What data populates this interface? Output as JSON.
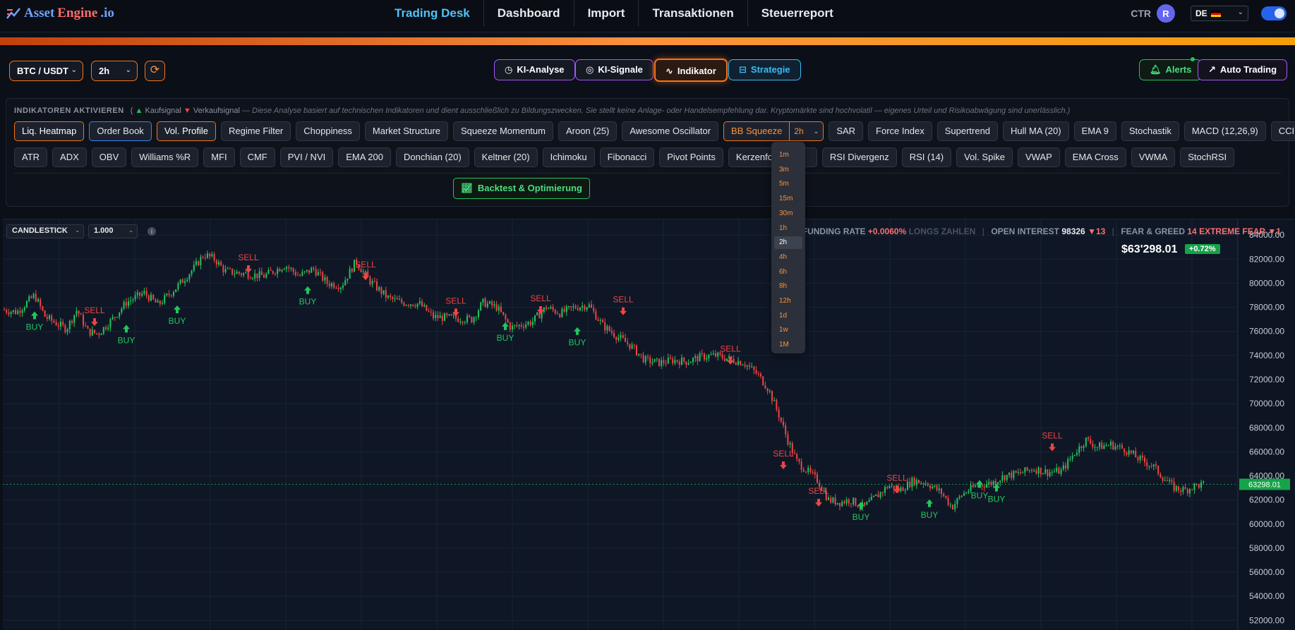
{
  "app": {
    "logo_asset": "Asset",
    "logo_engine": "Engine",
    "logo_io": ".io"
  },
  "nav": [
    {
      "label": "Trading Desk",
      "active": true
    },
    {
      "label": "Dashboard"
    },
    {
      "label": "Import"
    },
    {
      "label": "Transaktionen"
    },
    {
      "label": "Steuerreport"
    }
  ],
  "top_right": {
    "ctr_label": "CTR",
    "avatar_initial": "R",
    "language": "DE"
  },
  "controls": {
    "pair": "BTC / USDT",
    "timeframe": "2h",
    "ki_analyse": "KI-Analyse",
    "ki_signale": "KI-Signale",
    "indikator": "Indikator",
    "strategie": "Strategie",
    "alerts": "Alerts",
    "auto_trading": "Auto Trading"
  },
  "indicators_panel": {
    "heading": "INDIKATOREN AKTIVIEREN",
    "buy_legend": "Kaufsignal",
    "sell_legend": "Verkaufsignal",
    "disclaimer": "— Diese Analyse basiert auf technischen Indikatoren und dient ausschließlich zu Bildungszwecken. Sie stellt keine Anlage- oder Handelsempfehlung dar. Kryptomärkte sind hochvolatil — eigenes Urteil und Risikoabwägung sind unerlässlich.)",
    "row1": [
      "Liq. Heatmap",
      "Order Book",
      "Vol. Profile",
      "Regime Filter",
      "Choppiness",
      "Market Structure",
      "Squeeze Momentum",
      "Aroon (25)",
      "Awesome Oscillator",
      "BB Squeeze",
      "SAR",
      "Force Index",
      "Supertrend",
      "Hull MA (20)",
      "EMA 9",
      "Stochastik",
      "MACD (12,26,9)",
      "CCI"
    ],
    "row2": [
      "ATR",
      "ADX",
      "OBV",
      "Williams %R",
      "MFI",
      "CMF",
      "PVI / NVI",
      "EMA 200",
      "Donchian (20)",
      "Keltner (20)",
      "Ichimoku",
      "Fibonacci",
      "Pivot Points",
      "Kerzenformat",
      "RSI Divergenz",
      "RSI (14)",
      "Vol. Spike",
      "VWAP",
      "EMA Cross",
      "VWMA",
      "StochRSI"
    ],
    "bb_squeeze_timeframe": "2h",
    "backtest_label": "Backtest & Optimierung"
  },
  "timeframe_dropdown": {
    "options": [
      "1m",
      "3m",
      "5m",
      "15m",
      "30m",
      "1h",
      "2h",
      "4h",
      "6h",
      "8h",
      "12h",
      "1d",
      "1w",
      "1M"
    ],
    "selected": "2h"
  },
  "chart_toolbar": {
    "chart_type": "CANDLESTICK",
    "scale": "1.000"
  },
  "market_stats": {
    "funding_label": "FUNDING RATE",
    "funding_value": "+0.0060%",
    "funding_note": "LONGS ZAHLEN",
    "oi_label": "OPEN INTEREST",
    "oi_value": "98326",
    "oi_change": "▼13",
    "fg_label": "FEAR & GREED",
    "fg_value": "14",
    "fg_text": "EXTREME FEAR",
    "fg_change": "▼1"
  },
  "price": {
    "current": "$63'298.01",
    "change": "+0.72%",
    "axis_label": "63298.01"
  },
  "chart_data": {
    "type": "candlestick",
    "y_ticks": [
      "84000.00",
      "82000.00",
      "80000.00",
      "78000.00",
      "76000.00",
      "74000.00",
      "72000.00",
      "70000.00",
      "68000.00",
      "66000.00",
      "64000.00",
      "62000.00",
      "60000.00",
      "58000.00",
      "56000.00",
      "54000.00",
      "52000.00"
    ],
    "ylim": [
      51200,
      85300
    ],
    "current_price": 63298.01,
    "buy_label": "BUY",
    "sell_label": "SELL",
    "path": [
      [
        0,
        77800
      ],
      [
        20,
        77600
      ],
      [
        45,
        79000
      ],
      [
        60,
        77200
      ],
      [
        90,
        76200
      ],
      [
        105,
        77800
      ],
      [
        120,
        76000
      ],
      [
        135,
        75800
      ],
      [
        155,
        77000
      ],
      [
        175,
        78400
      ],
      [
        200,
        79200
      ],
      [
        220,
        78200
      ],
      [
        245,
        79600
      ],
      [
        270,
        81200
      ],
      [
        285,
        82400
      ],
      [
        300,
        82000
      ],
      [
        315,
        81000
      ],
      [
        340,
        80800
      ],
      [
        370,
        80600
      ],
      [
        400,
        81500
      ],
      [
        420,
        80600
      ],
      [
        440,
        81200
      ],
      [
        460,
        80000
      ],
      [
        480,
        79800
      ],
      [
        500,
        81800
      ],
      [
        520,
        80200
      ],
      [
        545,
        78800
      ],
      [
        565,
        78400
      ],
      [
        590,
        78300
      ],
      [
        610,
        77200
      ],
      [
        640,
        77100
      ],
      [
        665,
        77000
      ],
      [
        680,
        78400
      ],
      [
        700,
        78000
      ],
      [
        720,
        76300
      ],
      [
        750,
        76800
      ],
      [
        770,
        78000
      ],
      [
        790,
        77500
      ],
      [
        810,
        78000
      ],
      [
        830,
        78200
      ],
      [
        850,
        76500
      ],
      [
        870,
        75600
      ],
      [
        890,
        74800
      ],
      [
        910,
        73600
      ],
      [
        930,
        73400
      ],
      [
        950,
        73600
      ],
      [
        970,
        73500
      ],
      [
        990,
        73900
      ],
      [
        1010,
        74000
      ],
      [
        1030,
        73700
      ],
      [
        1050,
        73400
      ],
      [
        1070,
        72400
      ],
      [
        1085,
        71200
      ],
      [
        1100,
        69000
      ],
      [
        1112,
        67000
      ],
      [
        1125,
        65200
      ],
      [
        1140,
        64400
      ],
      [
        1155,
        63600
      ],
      [
        1170,
        62000
      ],
      [
        1185,
        61800
      ],
      [
        1200,
        62000
      ],
      [
        1220,
        61400
      ],
      [
        1240,
        62400
      ],
      [
        1255,
        63200
      ],
      [
        1270,
        62800
      ],
      [
        1290,
        63600
      ],
      [
        1310,
        63400
      ],
      [
        1330,
        62600
      ],
      [
        1345,
        61400
      ],
      [
        1360,
        62500
      ],
      [
        1380,
        63200
      ],
      [
        1400,
        63400
      ],
      [
        1420,
        64000
      ],
      [
        1440,
        64200
      ],
      [
        1460,
        64600
      ],
      [
        1480,
        64300
      ],
      [
        1500,
        64400
      ],
      [
        1520,
        66000
      ],
      [
        1535,
        67000
      ],
      [
        1550,
        66400
      ],
      [
        1570,
        66600
      ],
      [
        1590,
        66200
      ],
      [
        1610,
        65400
      ],
      [
        1630,
        64800
      ],
      [
        1645,
        63800
      ],
      [
        1660,
        63000
      ],
      [
        1675,
        62800
      ],
      [
        1690,
        63200
      ],
      [
        1704,
        63300
      ]
    ],
    "signals": [
      {
        "type": "buy",
        "x": 45,
        "price": 77300
      },
      {
        "type": "sell",
        "x": 130,
        "price": 76800
      },
      {
        "type": "buy",
        "x": 175,
        "price": 76200
      },
      {
        "type": "buy",
        "x": 247,
        "price": 77800
      },
      {
        "type": "sell",
        "x": 348,
        "price": 81200
      },
      {
        "type": "buy",
        "x": 432,
        "price": 79400
      },
      {
        "type": "sell",
        "x": 514,
        "price": 80600
      },
      {
        "type": "sell",
        "x": 642,
        "price": 77600
      },
      {
        "type": "buy",
        "x": 712,
        "price": 76400
      },
      {
        "type": "sell",
        "x": 762,
        "price": 77800
      },
      {
        "type": "buy",
        "x": 814,
        "price": 76000
      },
      {
        "type": "sell",
        "x": 879,
        "price": 77700
      },
      {
        "type": "sell",
        "x": 1031,
        "price": 73600
      },
      {
        "type": "sell",
        "x": 1106,
        "price": 64900
      },
      {
        "type": "sell",
        "x": 1156,
        "price": 61800
      },
      {
        "type": "buy",
        "x": 1216,
        "price": 61500
      },
      {
        "type": "sell",
        "x": 1267,
        "price": 62900
      },
      {
        "type": "buy",
        "x": 1313,
        "price": 61700
      },
      {
        "type": "buy",
        "x": 1384,
        "price": 63300
      },
      {
        "type": "buy",
        "x": 1408,
        "price": 63000
      },
      {
        "type": "sell",
        "x": 1487,
        "price": 66400
      }
    ]
  }
}
